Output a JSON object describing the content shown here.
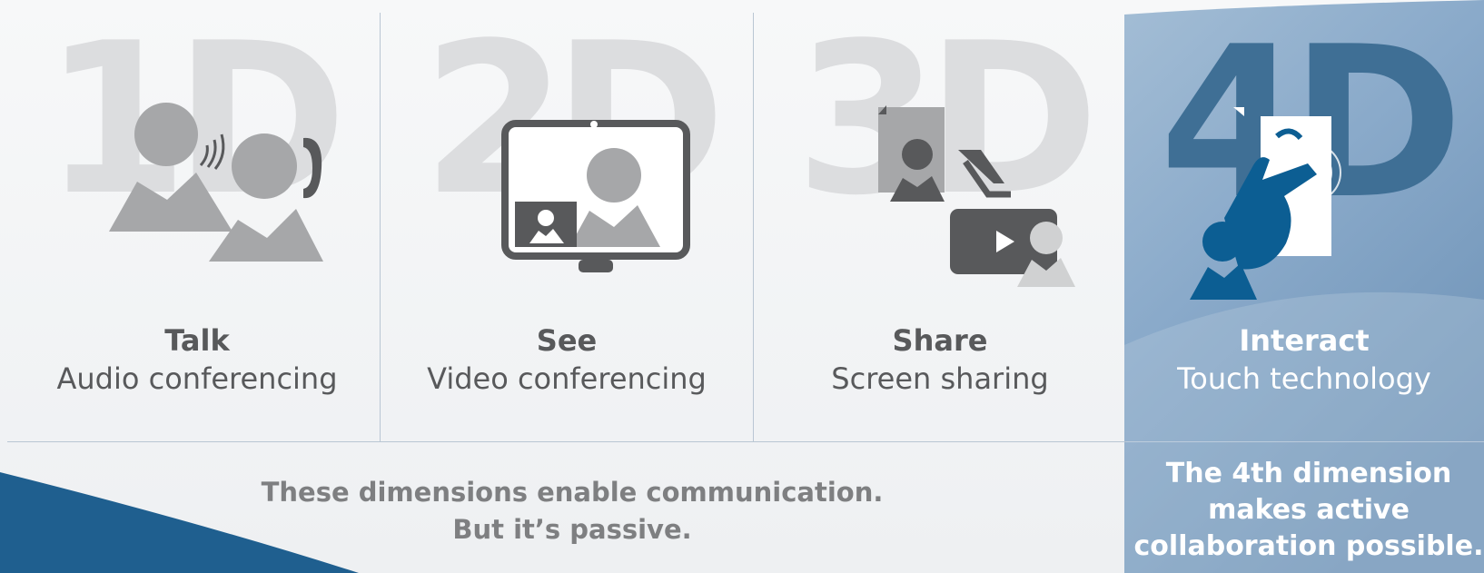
{
  "columns": [
    {
      "big": "1D",
      "title": "Talk",
      "subtitle": "Audio conferencing",
      "icon": "audio-call-icon"
    },
    {
      "big": "2D",
      "title": "See",
      "subtitle": "Video conferencing",
      "icon": "video-monitor-icon"
    },
    {
      "big": "3D",
      "title": "Share",
      "subtitle": "Screen sharing",
      "icon": "screen-share-icon"
    },
    {
      "big": "4D",
      "title": "Interact",
      "subtitle": "Touch technology",
      "icon": "touch-hand-icon"
    }
  ],
  "captions": {
    "passive_line1": "These dimensions enable communication.",
    "passive_line2": "But it’s passive.",
    "active_line1": "The 4th dimension",
    "active_line2": "makes active",
    "active_line3": "collaboration possible."
  },
  "colors": {
    "accent_blue": "#1f5f8f",
    "icon_gray": "#a6a7a9",
    "dark_gray": "#58595b",
    "panel_blue": "#7fa3c4",
    "big_letter_gray": "#dcdddf"
  }
}
